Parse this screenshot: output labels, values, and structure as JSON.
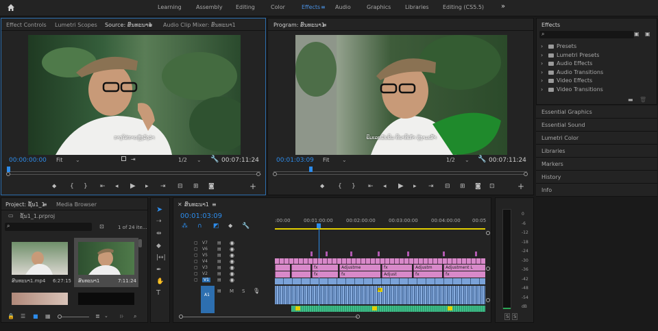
{
  "workspaces": [
    "Learning",
    "Assembly",
    "Editing",
    "Color",
    "Effects",
    "Audio",
    "Graphics",
    "Libraries",
    "Editing (CS5.5)"
  ],
  "workspaces_active": "Effects",
  "more_icon": "»",
  "source": {
    "tabs": [
      "Effect Controls",
      "Lumetri Scopes",
      "Source: ສົນທະນາ1",
      "Audio Clip Mixer: ສົນທະນາ1"
    ],
    "timecode": "00:00:00:00",
    "fit": "Fit",
    "ratio": "1/2",
    "duration": "00:07:11:24",
    "subtitle": "ກາງໃສ່ກາຍຫຼັງລົງວ່າ"
  },
  "program": {
    "title": "Program: ສົນທະນາ1",
    "timecode": "00:01:03:09",
    "fit": "Fit",
    "ratio": "1/2",
    "duration": "00:07:11:24",
    "subtitle": "ພິມເລຍມັນພິມ ທີ່ນາທີ່ເກົ່າ ຮູ້ງາມເສົ້າ"
  },
  "effects": {
    "title": "Effects",
    "folders": [
      "Presets",
      "Lumetri Presets",
      "Audio Effects",
      "Audio Transitions",
      "Video Effects",
      "Video Transitions"
    ],
    "sections": [
      "Essential Graphics",
      "Essential Sound",
      "Lumetri Color",
      "Libraries",
      "Markers",
      "History",
      "Info"
    ]
  },
  "project": {
    "tab": "Project: ຊັ້ນ1_1",
    "tab2": "Media Browser",
    "file": "ຊັ້ນ1_1.prproj",
    "count": "1 of 24 ite...",
    "items": [
      {
        "name": "ສົນທະນາ1.mp4",
        "dur": "6:27:15"
      },
      {
        "name": "ສົນທະນາ1",
        "dur": "7:11:24"
      }
    ]
  },
  "timeline": {
    "tab": "ສົນທະນາ1",
    "timecode": "00:01:03:09",
    "ruler": [
      ":00:00",
      "00:01:00:00",
      "00:02:00:00",
      "00:03:00:00",
      "00:04:00:00",
      "00:05"
    ],
    "video_tracks": [
      "V7",
      "V6",
      "V5",
      "V4",
      "V3",
      "V2",
      "V1"
    ],
    "audio_tracks": [
      "A1"
    ],
    "clip_label": "Adjustme",
    "clip_label2": "Adjustm",
    "clip_label3": "Adjust",
    "clip_label4": "Adjustment L"
  },
  "meter": {
    "ticks": [
      "0",
      "-6",
      "-12",
      "-18",
      "-24",
      "-30",
      "-36",
      "-42",
      "-48",
      "-54",
      "dB"
    ],
    "solo": "S"
  },
  "colors": {
    "accent": "#2d8ceb",
    "pink": "#d889c9",
    "blue_clip": "#7aa2d8",
    "green_audio": "#3fc08a",
    "yellow_bar": "#e4d000"
  }
}
